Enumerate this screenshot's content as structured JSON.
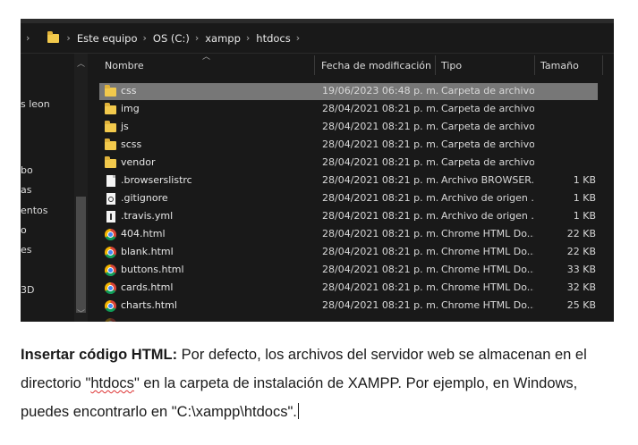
{
  "address_bar": {
    "breadcrumbs": [
      "Este equipo",
      "OS (C:)",
      "xampp",
      "htdocs"
    ]
  },
  "nav_pane": {
    "items": [
      "s leon",
      "bo",
      "as",
      "entos",
      "o",
      "es",
      "3D"
    ]
  },
  "columns": {
    "name": "Nombre",
    "date": "Fecha de modificación",
    "type": "Tipo",
    "size": "Tamaño"
  },
  "files": [
    {
      "name": "css",
      "date": "19/06/2023 06:48 p. m.",
      "type": "Carpeta de archivos",
      "size": "",
      "icon": "folder-icon",
      "selected": true
    },
    {
      "name": "img",
      "date": "28/04/2021 08:21 p. m.",
      "type": "Carpeta de archivos",
      "size": "",
      "icon": "folder-icon"
    },
    {
      "name": "js",
      "date": "28/04/2021 08:21 p. m.",
      "type": "Carpeta de archivos",
      "size": "",
      "icon": "folder-icon"
    },
    {
      "name": "scss",
      "date": "28/04/2021 08:21 p. m.",
      "type": "Carpeta de archivos",
      "size": "",
      "icon": "folder-icon"
    },
    {
      "name": "vendor",
      "date": "28/04/2021 08:21 p. m.",
      "type": "Carpeta de archivos",
      "size": "",
      "icon": "folder-icon"
    },
    {
      "name": ".browserslistrc",
      "date": "28/04/2021 08:21 p. m.",
      "type": "Archivo BROWSER...",
      "size": "1 KB",
      "icon": "file-icon"
    },
    {
      "name": ".gitignore",
      "date": "28/04/2021 08:21 p. m.",
      "type": "Archivo de origen ...",
      "size": "1 KB",
      "icon": "gear-file-icon"
    },
    {
      "name": ".travis.yml",
      "date": "28/04/2021 08:21 p. m.",
      "type": "Archivo de origen ...",
      "size": "1 KB",
      "icon": "yml-file-icon"
    },
    {
      "name": "404.html",
      "date": "28/04/2021 08:21 p. m.",
      "type": "Chrome HTML Do...",
      "size": "22 KB",
      "icon": "chrome-icon"
    },
    {
      "name": "blank.html",
      "date": "28/04/2021 08:21 p. m.",
      "type": "Chrome HTML Do...",
      "size": "22 KB",
      "icon": "chrome-icon"
    },
    {
      "name": "buttons.html",
      "date": "28/04/2021 08:21 p. m.",
      "type": "Chrome HTML Do...",
      "size": "33 KB",
      "icon": "chrome-icon"
    },
    {
      "name": "cards.html",
      "date": "28/04/2021 08:21 p. m.",
      "type": "Chrome HTML Do...",
      "size": "32 KB",
      "icon": "chrome-icon"
    },
    {
      "name": "charts.html",
      "date": "28/04/2021 08:21 p. m.",
      "type": "Chrome HTML Do...",
      "size": "25 KB",
      "icon": "chrome-icon"
    }
  ],
  "paragraph": {
    "bold_lead": "Insertar código HTML:",
    "text_1": " Por defecto, los archivos del servidor web se almacenan en el directorio \"",
    "misspelled": "htdocs",
    "text_2": "\" en la carpeta de instalación de XAMPP. Por ejemplo, en Windows, puedes encontrarlo en \"C:\\xampp\\htdocs\"."
  }
}
